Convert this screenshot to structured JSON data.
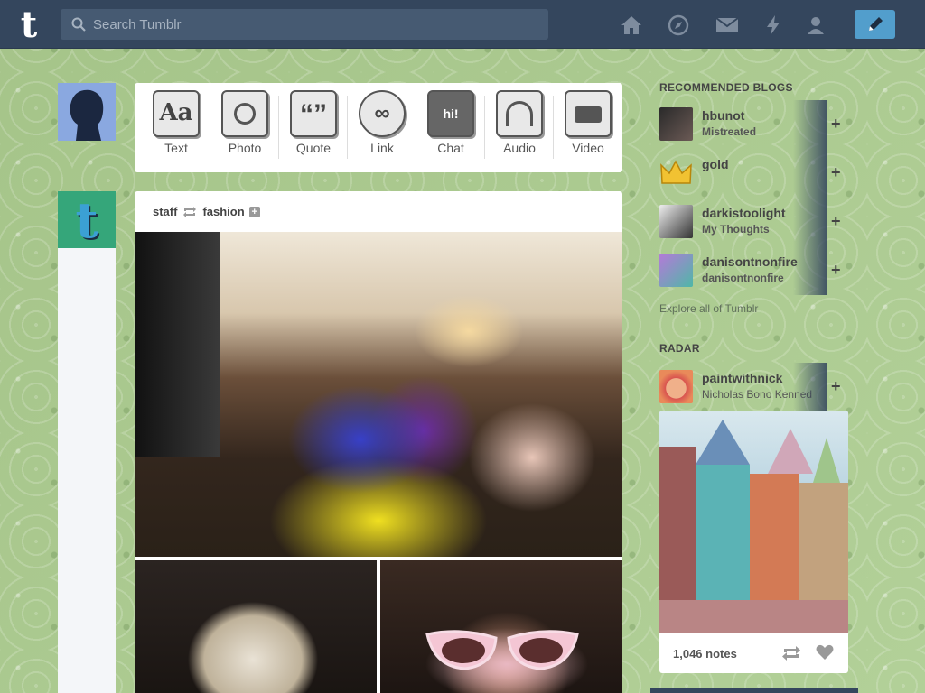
{
  "topbar": {
    "logo": "t",
    "search_placeholder": "Search Tumblr",
    "nav": [
      "home-icon",
      "explore-icon",
      "inbox-icon",
      "activity-icon",
      "account-icon"
    ],
    "compose_icon": "pencil-icon",
    "colors": {
      "bar": "#34465d",
      "compose": "#529ecc"
    }
  },
  "post_types": [
    {
      "label": "Text",
      "icon": "text-icon"
    },
    {
      "label": "Photo",
      "icon": "photo-icon"
    },
    {
      "label": "Quote",
      "icon": "quote-icon"
    },
    {
      "label": "Link",
      "icon": "link-icon"
    },
    {
      "label": "Chat",
      "icon": "chat-icon"
    },
    {
      "label": "Audio",
      "icon": "audio-icon"
    },
    {
      "label": "Video",
      "icon": "video-icon"
    }
  ],
  "post": {
    "author": "staff",
    "reblogged_from": "fashion",
    "follow_icon": "plus-icon"
  },
  "sidebar": {
    "recommended_title": "RECOMMENDED BLOGS",
    "recommended": [
      {
        "name": "hbunot",
        "sub": "Mistreated"
      },
      {
        "name": "gold",
        "sub": ""
      },
      {
        "name": "darkistoolight",
        "sub": "My Thoughts"
      },
      {
        "name": "danisontnonfire",
        "sub": "danisontnonfire"
      }
    ],
    "explore_link": "Explore all of Tumblr",
    "radar_title": "RADAR",
    "radar_blog": {
      "name": "paintwithnick",
      "sub": "Nicholas Bono Kenned"
    },
    "radar_notes": "1,046 notes"
  }
}
